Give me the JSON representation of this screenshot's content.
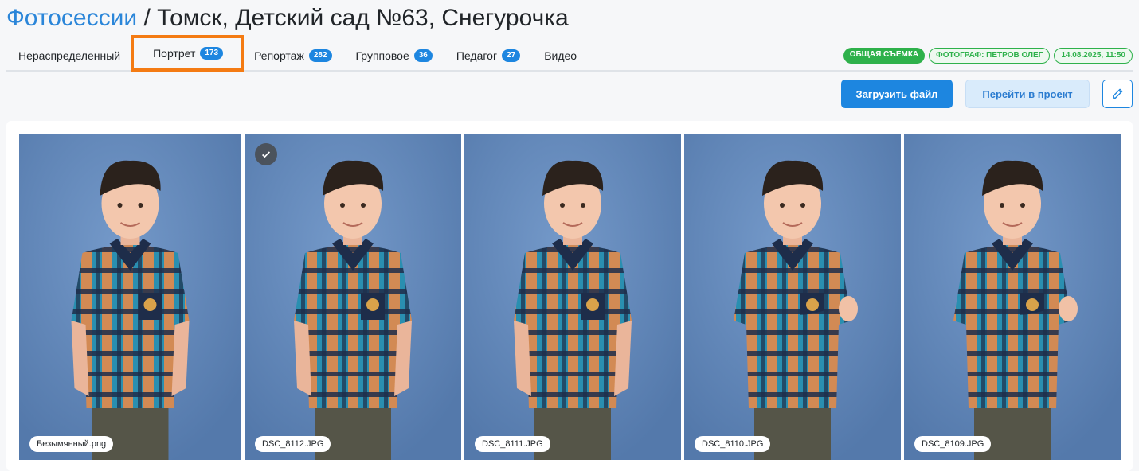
{
  "header": {
    "crumb": "Фотосессии",
    "separator": " / ",
    "title": "Томск, Детский сад №63, Снегурочка"
  },
  "tabs": [
    {
      "label": "Нераспределенный",
      "count": null
    },
    {
      "label": "Портрет",
      "count": "173",
      "active": true
    },
    {
      "label": "Репортаж",
      "count": "282"
    },
    {
      "label": "Групповое",
      "count": "36"
    },
    {
      "label": "Педагог",
      "count": "27"
    },
    {
      "label": "Видео",
      "count": null
    }
  ],
  "meta": {
    "type": "ОБЩАЯ СЪЕМКА",
    "photographer": "ФОТОГРАФ: ПЕТРОВ ОЛЕГ",
    "datetime": "14.08.2025, 11:50"
  },
  "actions": {
    "upload": "Загрузить файл",
    "go_project": "Перейти в проект",
    "edit_icon": "pencil-icon"
  },
  "photos": [
    {
      "name": "Безымянный.png",
      "selected": false,
      "pose": "hands-in-pockets"
    },
    {
      "name": "DSC_8112.JPG",
      "selected": true,
      "pose": "hands-in-pockets"
    },
    {
      "name": "DSC_8111.JPG",
      "selected": false,
      "pose": "hands-in-pockets"
    },
    {
      "name": "DSC_8110.JPG",
      "selected": false,
      "pose": "arms-crossed"
    },
    {
      "name": "DSC_8109.JPG",
      "selected": false,
      "pose": "arms-crossed"
    }
  ],
  "colors": {
    "accent": "#1d86e0",
    "highlight": "#f47b13",
    "success": "#2eb14b",
    "backdrop": "#5479ab"
  }
}
